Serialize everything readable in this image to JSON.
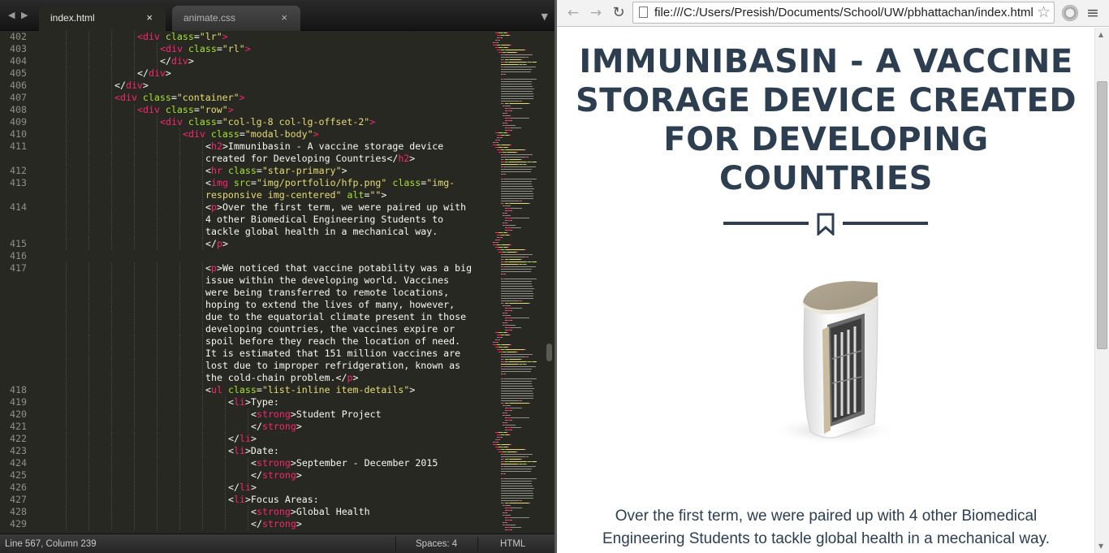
{
  "editor": {
    "tabs": [
      {
        "label": "index.html",
        "active": true
      },
      {
        "label": "animate.css",
        "active": false
      }
    ],
    "close_glyph": "×",
    "nav_left_glyph": "◀",
    "nav_right_glyph": "▶",
    "overflow_glyph": "▼",
    "status": {
      "position": "Line 567, Column 239",
      "indent": "Spaces: 4",
      "syntax": "HTML"
    },
    "lines": [
      {
        "n": "402",
        "i": 4,
        "t": [
          [
            "tg",
            "<div "
          ],
          [
            "at",
            "class"
          ],
          [
            "tx",
            "="
          ],
          [
            "st",
            "\"lr\""
          ],
          [
            "tg",
            ">"
          ]
        ]
      },
      {
        "n": "403",
        "i": 5,
        "t": [
          [
            "tg",
            "<div "
          ],
          [
            "at",
            "class"
          ],
          [
            "tx",
            "="
          ],
          [
            "st",
            "\"rl\""
          ],
          [
            "tg",
            ">"
          ]
        ]
      },
      {
        "n": "404",
        "i": 5,
        "t": [
          [
            "tx",
            "</"
          ],
          [
            "tg",
            "div"
          ],
          [
            "tx",
            ">"
          ]
        ]
      },
      {
        "n": "405",
        "i": 4,
        "t": [
          [
            "tx",
            "</"
          ],
          [
            "tg",
            "div"
          ],
          [
            "tx",
            ">"
          ]
        ]
      },
      {
        "n": "406",
        "i": 3,
        "t": [
          [
            "tx",
            "</"
          ],
          [
            "tg",
            "div"
          ],
          [
            "tx",
            ">"
          ]
        ]
      },
      {
        "n": "407",
        "i": 3,
        "t": [
          [
            "tg",
            "<div "
          ],
          [
            "at",
            "class"
          ],
          [
            "tx",
            "="
          ],
          [
            "st",
            "\"container\""
          ],
          [
            "tg",
            ">"
          ]
        ]
      },
      {
        "n": "408",
        "i": 4,
        "t": [
          [
            "tg",
            "<div "
          ],
          [
            "at",
            "class"
          ],
          [
            "tx",
            "="
          ],
          [
            "st",
            "\"row\""
          ],
          [
            "tg",
            ">"
          ]
        ]
      },
      {
        "n": "409",
        "i": 5,
        "t": [
          [
            "tg",
            "<div "
          ],
          [
            "at",
            "class"
          ],
          [
            "tx",
            "="
          ],
          [
            "st",
            "\"col-lg-8 col-lg-offset-2\""
          ],
          [
            "tg",
            ">"
          ]
        ]
      },
      {
        "n": "410",
        "i": 6,
        "t": [
          [
            "tg",
            "<div "
          ],
          [
            "at",
            "class"
          ],
          [
            "tx",
            "="
          ],
          [
            "st",
            "\"modal-body\""
          ],
          [
            "tg",
            ">"
          ]
        ]
      },
      {
        "n": "411",
        "i": 7,
        "t": [
          [
            "tx",
            "<"
          ],
          [
            "tg",
            "h2"
          ],
          [
            "tx",
            ">Immunibasin - A vaccine storage device"
          ]
        ]
      },
      {
        "n": "",
        "i": 7,
        "t": [
          [
            "tx",
            "created for Developing Countries</"
          ],
          [
            "tg",
            "h2"
          ],
          [
            "tx",
            ">"
          ]
        ]
      },
      {
        "n": "412",
        "i": 7,
        "t": [
          [
            "tx",
            "<"
          ],
          [
            "tg",
            "hr "
          ],
          [
            "at",
            "class"
          ],
          [
            "tx",
            "="
          ],
          [
            "st",
            "\"star-primary\""
          ],
          [
            "tx",
            ">"
          ]
        ]
      },
      {
        "n": "413",
        "i": 7,
        "t": [
          [
            "tx",
            "<"
          ],
          [
            "tg",
            "img "
          ],
          [
            "at",
            "src"
          ],
          [
            "tx",
            "="
          ],
          [
            "st",
            "\"img/portfolio/hfp.png\""
          ],
          [
            "tx",
            " "
          ],
          [
            "at",
            "class"
          ],
          [
            "tx",
            "="
          ],
          [
            "st",
            "\"img-"
          ]
        ]
      },
      {
        "n": "",
        "i": 7,
        "t": [
          [
            "st",
            "responsive img-centered\""
          ],
          [
            "tx",
            " "
          ],
          [
            "at",
            "alt"
          ],
          [
            "tx",
            "="
          ],
          [
            "st",
            "\"\""
          ],
          [
            "tx",
            ">"
          ]
        ]
      },
      {
        "n": "414",
        "i": 7,
        "t": [
          [
            "tx",
            "<"
          ],
          [
            "tg",
            "p"
          ],
          [
            "tx",
            ">Over the first term, we were paired up with"
          ]
        ]
      },
      {
        "n": "",
        "i": 7,
        "t": [
          [
            "tx",
            "4 other Biomedical Engineering Students to"
          ]
        ]
      },
      {
        "n": "",
        "i": 7,
        "t": [
          [
            "tx",
            "tackle global health in a mechanical way."
          ]
        ]
      },
      {
        "n": "415",
        "i": 7,
        "t": [
          [
            "tx",
            "</"
          ],
          [
            "tg",
            "p"
          ],
          [
            "tx",
            ">"
          ]
        ]
      },
      {
        "n": "416",
        "i": 0,
        "t": []
      },
      {
        "n": "417",
        "i": 7,
        "t": [
          [
            "tx",
            "<"
          ],
          [
            "tg",
            "p"
          ],
          [
            "tx",
            ">We noticed that vaccine potability was a big"
          ]
        ]
      },
      {
        "n": "",
        "i": 7,
        "t": [
          [
            "tx",
            "issue within the developing world. Vaccines"
          ]
        ]
      },
      {
        "n": "",
        "i": 7,
        "t": [
          [
            "tx",
            "were being transferred to remote locations,"
          ]
        ]
      },
      {
        "n": "",
        "i": 7,
        "t": [
          [
            "tx",
            "hoping to extend the lives of many, however,"
          ]
        ]
      },
      {
        "n": "",
        "i": 7,
        "t": [
          [
            "tx",
            "due to the equatorial climate present in those"
          ]
        ]
      },
      {
        "n": "",
        "i": 7,
        "t": [
          [
            "tx",
            "developing countries, the vaccines expire or"
          ]
        ]
      },
      {
        "n": "",
        "i": 7,
        "t": [
          [
            "tx",
            "spoil before they reach the location of need."
          ]
        ]
      },
      {
        "n": "",
        "i": 7,
        "t": [
          [
            "tx",
            "It is estimated that 151 million vaccines are"
          ]
        ]
      },
      {
        "n": "",
        "i": 7,
        "t": [
          [
            "tx",
            "lost due to improper refridgeration, known as"
          ]
        ]
      },
      {
        "n": "",
        "i": 7,
        "t": [
          [
            "tx",
            "the cold-chain problem.</"
          ],
          [
            "tg",
            "p"
          ],
          [
            "tx",
            ">"
          ]
        ]
      },
      {
        "n": "418",
        "i": 7,
        "t": [
          [
            "tx",
            "<"
          ],
          [
            "tg",
            "ul "
          ],
          [
            "at",
            "class"
          ],
          [
            "tx",
            "="
          ],
          [
            "st",
            "\"list-inline item-details\""
          ],
          [
            "tx",
            ">"
          ]
        ]
      },
      {
        "n": "419",
        "i": 8,
        "t": [
          [
            "tx",
            "<"
          ],
          [
            "tg",
            "li"
          ],
          [
            "tx",
            ">Type:"
          ]
        ]
      },
      {
        "n": "420",
        "i": 9,
        "t": [
          [
            "tx",
            "<"
          ],
          [
            "tg",
            "strong"
          ],
          [
            "tx",
            ">Student Project"
          ]
        ]
      },
      {
        "n": "421",
        "i": 9,
        "t": [
          [
            "tx",
            "</"
          ],
          [
            "tg",
            "strong"
          ],
          [
            "tx",
            ">"
          ]
        ]
      },
      {
        "n": "422",
        "i": 8,
        "t": [
          [
            "tx",
            "</"
          ],
          [
            "tg",
            "li"
          ],
          [
            "tx",
            ">"
          ]
        ]
      },
      {
        "n": "423",
        "i": 8,
        "t": [
          [
            "tx",
            "<"
          ],
          [
            "tg",
            "li"
          ],
          [
            "tx",
            ">Date:"
          ]
        ]
      },
      {
        "n": "424",
        "i": 9,
        "t": [
          [
            "tx",
            "<"
          ],
          [
            "tg",
            "strong"
          ],
          [
            "tx",
            ">September - December 2015"
          ]
        ]
      },
      {
        "n": "425",
        "i": 9,
        "t": [
          [
            "tx",
            "</"
          ],
          [
            "tg",
            "strong"
          ],
          [
            "tx",
            ">"
          ]
        ]
      },
      {
        "n": "426",
        "i": 8,
        "t": [
          [
            "tx",
            "</"
          ],
          [
            "tg",
            "li"
          ],
          [
            "tx",
            ">"
          ]
        ]
      },
      {
        "n": "427",
        "i": 8,
        "t": [
          [
            "tx",
            "<"
          ],
          [
            "tg",
            "li"
          ],
          [
            "tx",
            ">Focus Areas:"
          ]
        ]
      },
      {
        "n": "428",
        "i": 9,
        "t": [
          [
            "tx",
            "<"
          ],
          [
            "tg",
            "strong"
          ],
          [
            "tx",
            ">Global Health"
          ]
        ]
      },
      {
        "n": "429",
        "i": 9,
        "t": [
          [
            "tx",
            "</"
          ],
          [
            "tg",
            "strong"
          ],
          [
            "tx",
            ">"
          ]
        ]
      }
    ]
  },
  "browser": {
    "url": "file:///C:/Users/Presish/Documents/School/UW/pbhattachan/index.html",
    "back_glyph": "←",
    "forward_glyph": "→",
    "reload_glyph": "↻",
    "star_glyph": "☆",
    "menu_glyph": "≡",
    "heading": "IMMUNIBASIN - A VACCINE STORAGE DEVICE CREATED FOR DEVELOPING COUNTRIES",
    "intro": "Over the first term, we were paired up with 4 other Biomedical Engineering Students to tackle global health in a mechanical way.",
    "icons": {
      "divider": "bookmark-icon",
      "product": "vaccine-storage-device-image"
    },
    "colors": {
      "heading": "#2c3e50",
      "editor_bg": "#272822",
      "tag": "#f92672",
      "attr": "#a6e22e",
      "string": "#e6db74"
    }
  }
}
